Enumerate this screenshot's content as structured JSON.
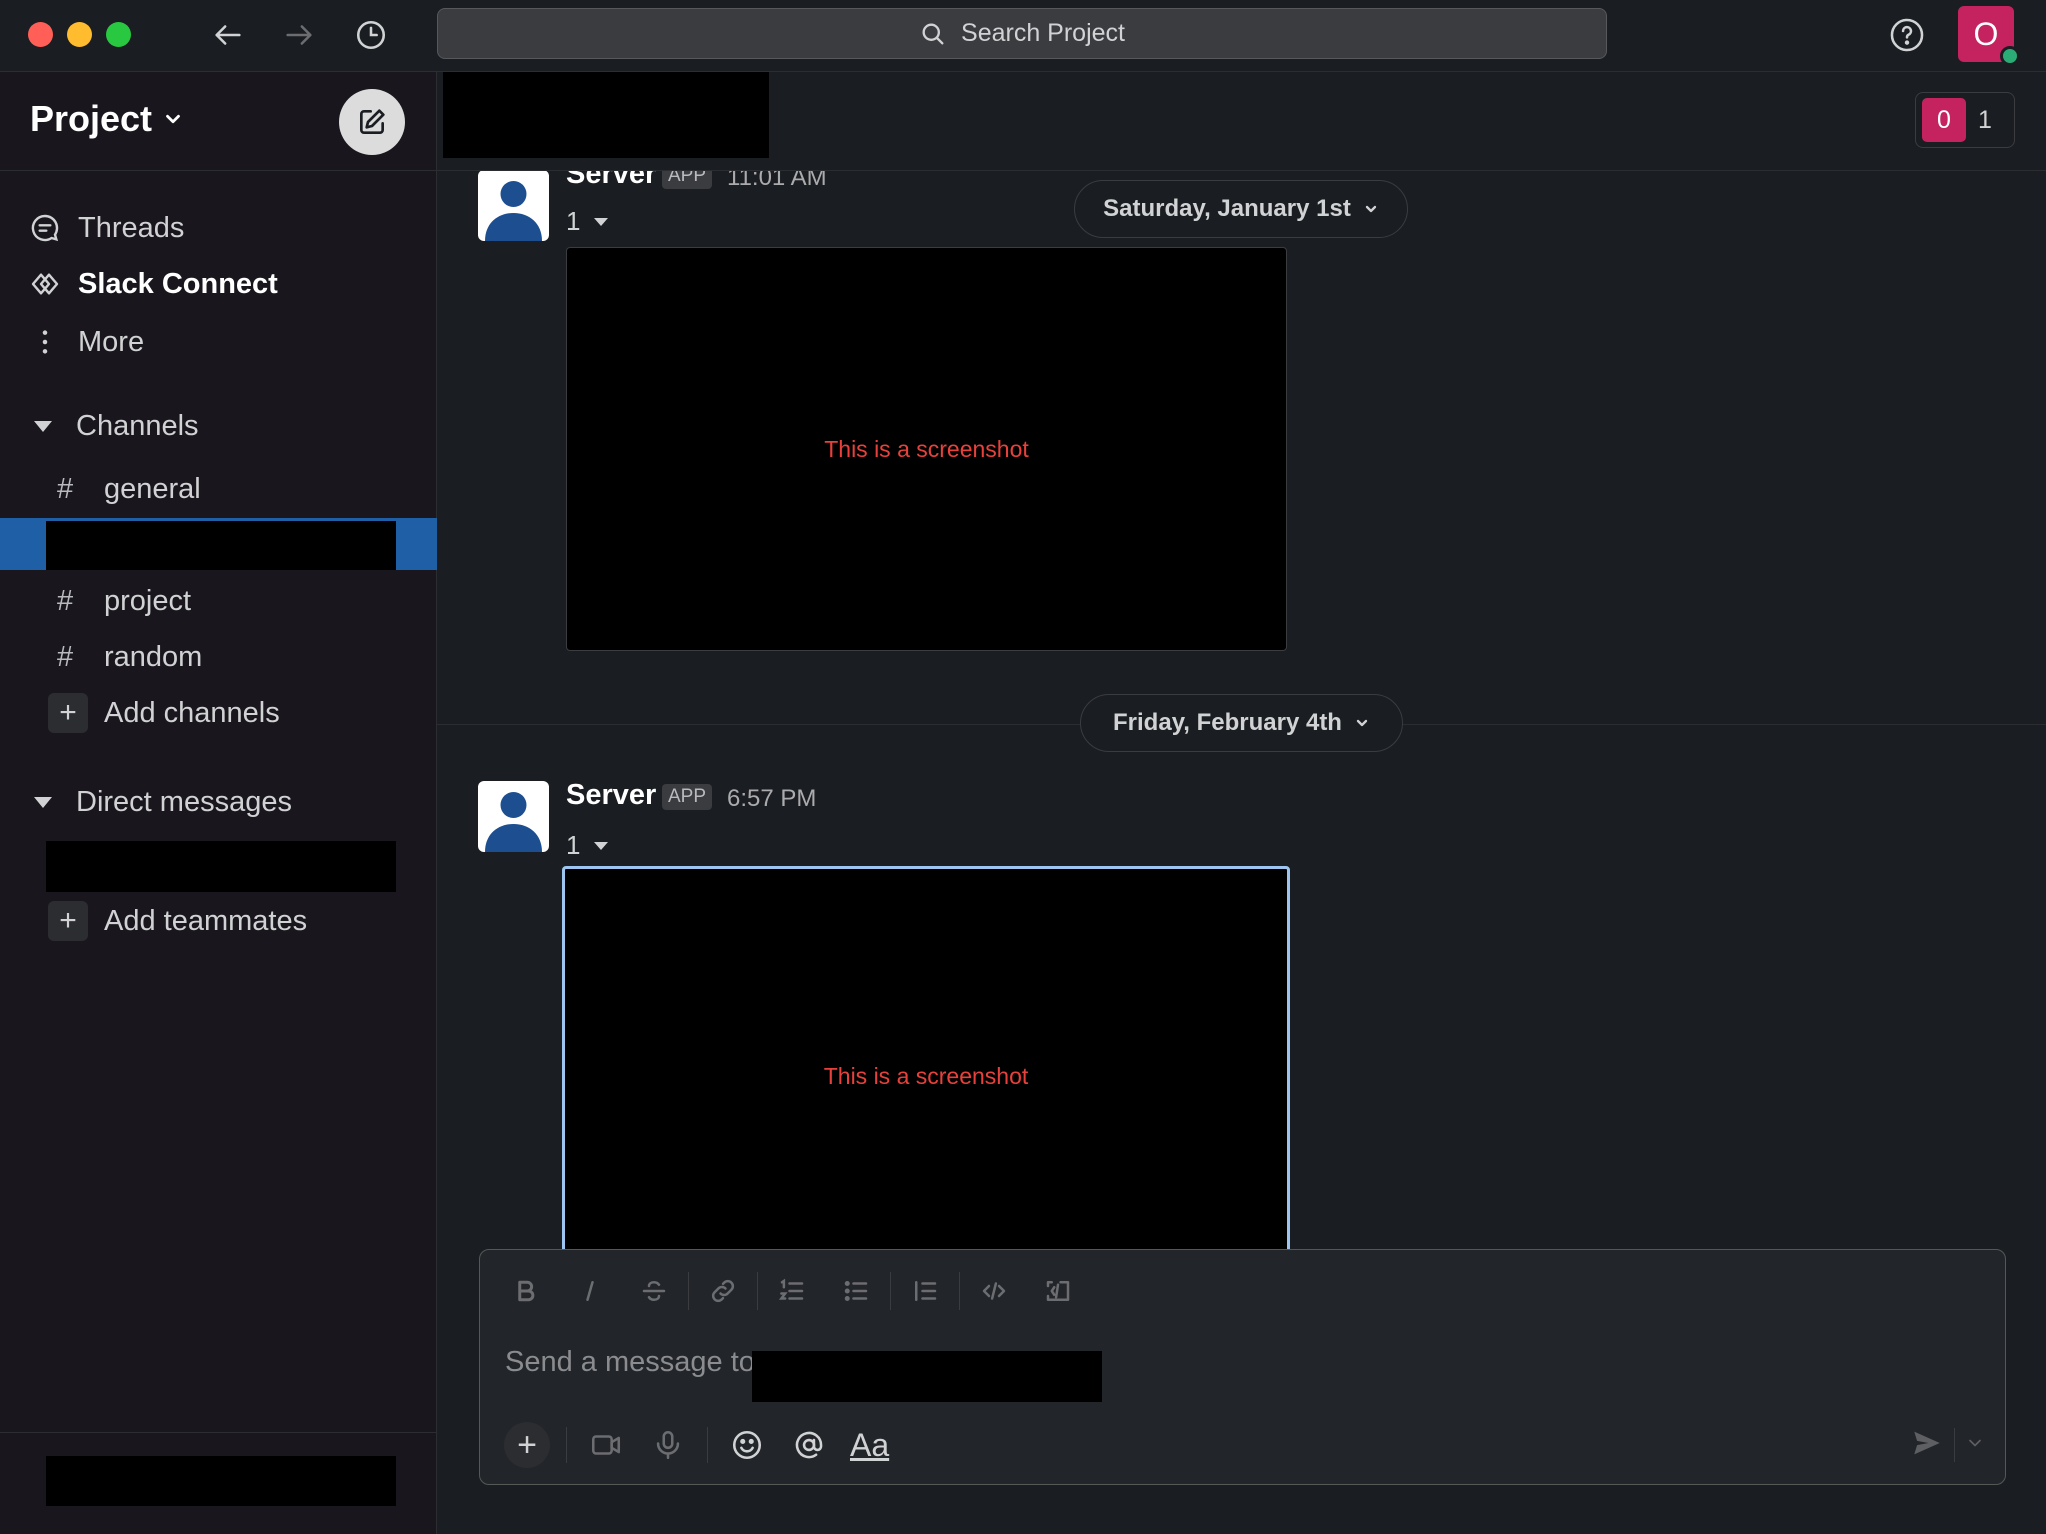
{
  "titlebar": {
    "search_placeholder": "Search Project",
    "user_initial": "O"
  },
  "sidebar": {
    "workspace_name": "Project",
    "nav": [
      {
        "label": "Threads",
        "icon": "threads-icon"
      },
      {
        "label": "Slack Connect",
        "icon": "slack-connect-icon"
      },
      {
        "label": "More",
        "icon": "more-vertical-icon"
      }
    ],
    "channels_header": "Channels",
    "channels": [
      {
        "name": "general"
      },
      {
        "name": "project"
      },
      {
        "name": "random"
      }
    ],
    "add_channels": "Add channels",
    "dm_header": "Direct messages",
    "add_teammates": "Add teammates"
  },
  "header": {
    "member_initial": "0",
    "member_count": "1"
  },
  "messages": [
    {
      "author": "Server",
      "badge": "APP",
      "time": "11:01 AM",
      "count": "1",
      "attachment_caption": "This is a screenshot"
    },
    {
      "author": "Server",
      "badge": "APP",
      "time": "6:57 PM",
      "count": "1",
      "attachment_caption": "This is a screenshot"
    }
  ],
  "dates": {
    "first": "Saturday, January 1st",
    "second": "Friday, February 4th"
  },
  "composer": {
    "placeholder": "Send a message to",
    "aa_label": "Aa"
  },
  "colors": {
    "accent_selected": "#1f5fa6",
    "avatar_brand": "#c4235f",
    "presence": "#2bac76",
    "caption_red": "#e8413b"
  }
}
